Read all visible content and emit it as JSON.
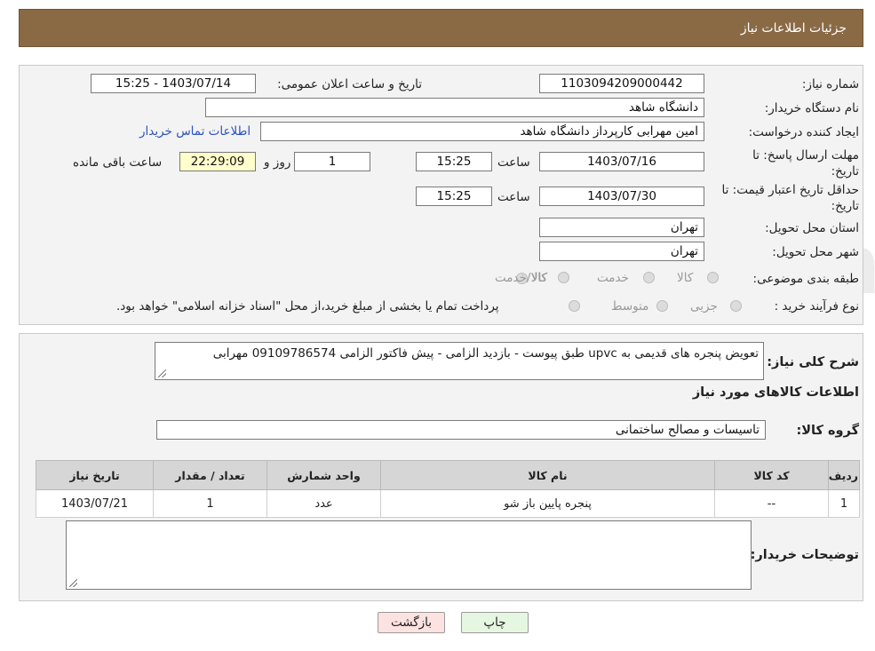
{
  "header": {
    "title": "جزئیات اطلاعات نیاز"
  },
  "form": {
    "need_number_label": "شماره نیاز:",
    "need_number": "1103094209000442",
    "announce_label": "تاریخ و ساعت اعلان عمومی:",
    "announce_value": "1403/07/14 - 15:25",
    "buyer_org_label": "نام دستگاه خریدار:",
    "buyer_org": "دانشگاه شاهد",
    "creator_label": "ایجاد کننده درخواست:",
    "creator": "امین مهرابی کارپرداز دانشگاه شاهد",
    "contact_link": "اطلاعات تماس خریدار",
    "deadline_label": "مهلت ارسال پاسخ: تا تاریخ:",
    "deadline_date": "1403/07/16",
    "time_label": "ساعت",
    "deadline_time": "15:25",
    "days_value": "1",
    "days_label": "روز و",
    "remaining_time": "22:29:09",
    "remaining_label": "ساعت باقی مانده",
    "validity_label": "حداقل تاریخ اعتبار قیمت: تا تاریخ:",
    "validity_date": "1403/07/30",
    "validity_time": "15:25",
    "province_label": "استان محل تحویل:",
    "province": "تهران",
    "city_label": "شهر محل تحویل:",
    "city": "تهران",
    "category_label": "طبقه بندی موضوعی:",
    "category_options": [
      "کالا",
      "خدمت",
      "کالا/خدمت"
    ],
    "process_label": "نوع فرآیند خرید :",
    "process_options": [
      "جزیی",
      "متوسط"
    ],
    "process_note": "پرداخت تمام یا بخشی از مبلغ خرید،از محل \"اسناد خزانه اسلامی\" خواهد بود."
  },
  "details": {
    "description_label": "شرح کلی نیاز:",
    "description": "تعویض پنجره های قدیمی به upvc طبق  پیوست - بازدید الزامی - پیش فاکتور الزامی 09109786574 مهرابی",
    "goods_info_title": "اطلاعات کالاهای مورد نیاز",
    "goods_group_label": "گروه کالا:",
    "goods_group": "تاسیسات و مصالح ساختمانی",
    "table": {
      "headers": [
        "ردیف",
        "کد کالا",
        "نام کالا",
        "واحد شمارش",
        "تعداد / مقدار",
        "تاریخ نیاز"
      ],
      "rows": [
        [
          "1",
          "--",
          "پنجره پایین باز شو",
          "عدد",
          "1",
          "1403/07/21"
        ]
      ]
    },
    "buyer_notes_label": "توضیحات خریدار:",
    "buyer_notes": ""
  },
  "buttons": {
    "print": "چاپ",
    "back": "بازگشت"
  },
  "watermark": {
    "text": "AriaTender.neT"
  },
  "colors": {
    "header_bg": "#8a6a45",
    "link": "#2a52be",
    "back_bg": "#fde2e2",
    "print_bg": "#e6f7e1"
  }
}
